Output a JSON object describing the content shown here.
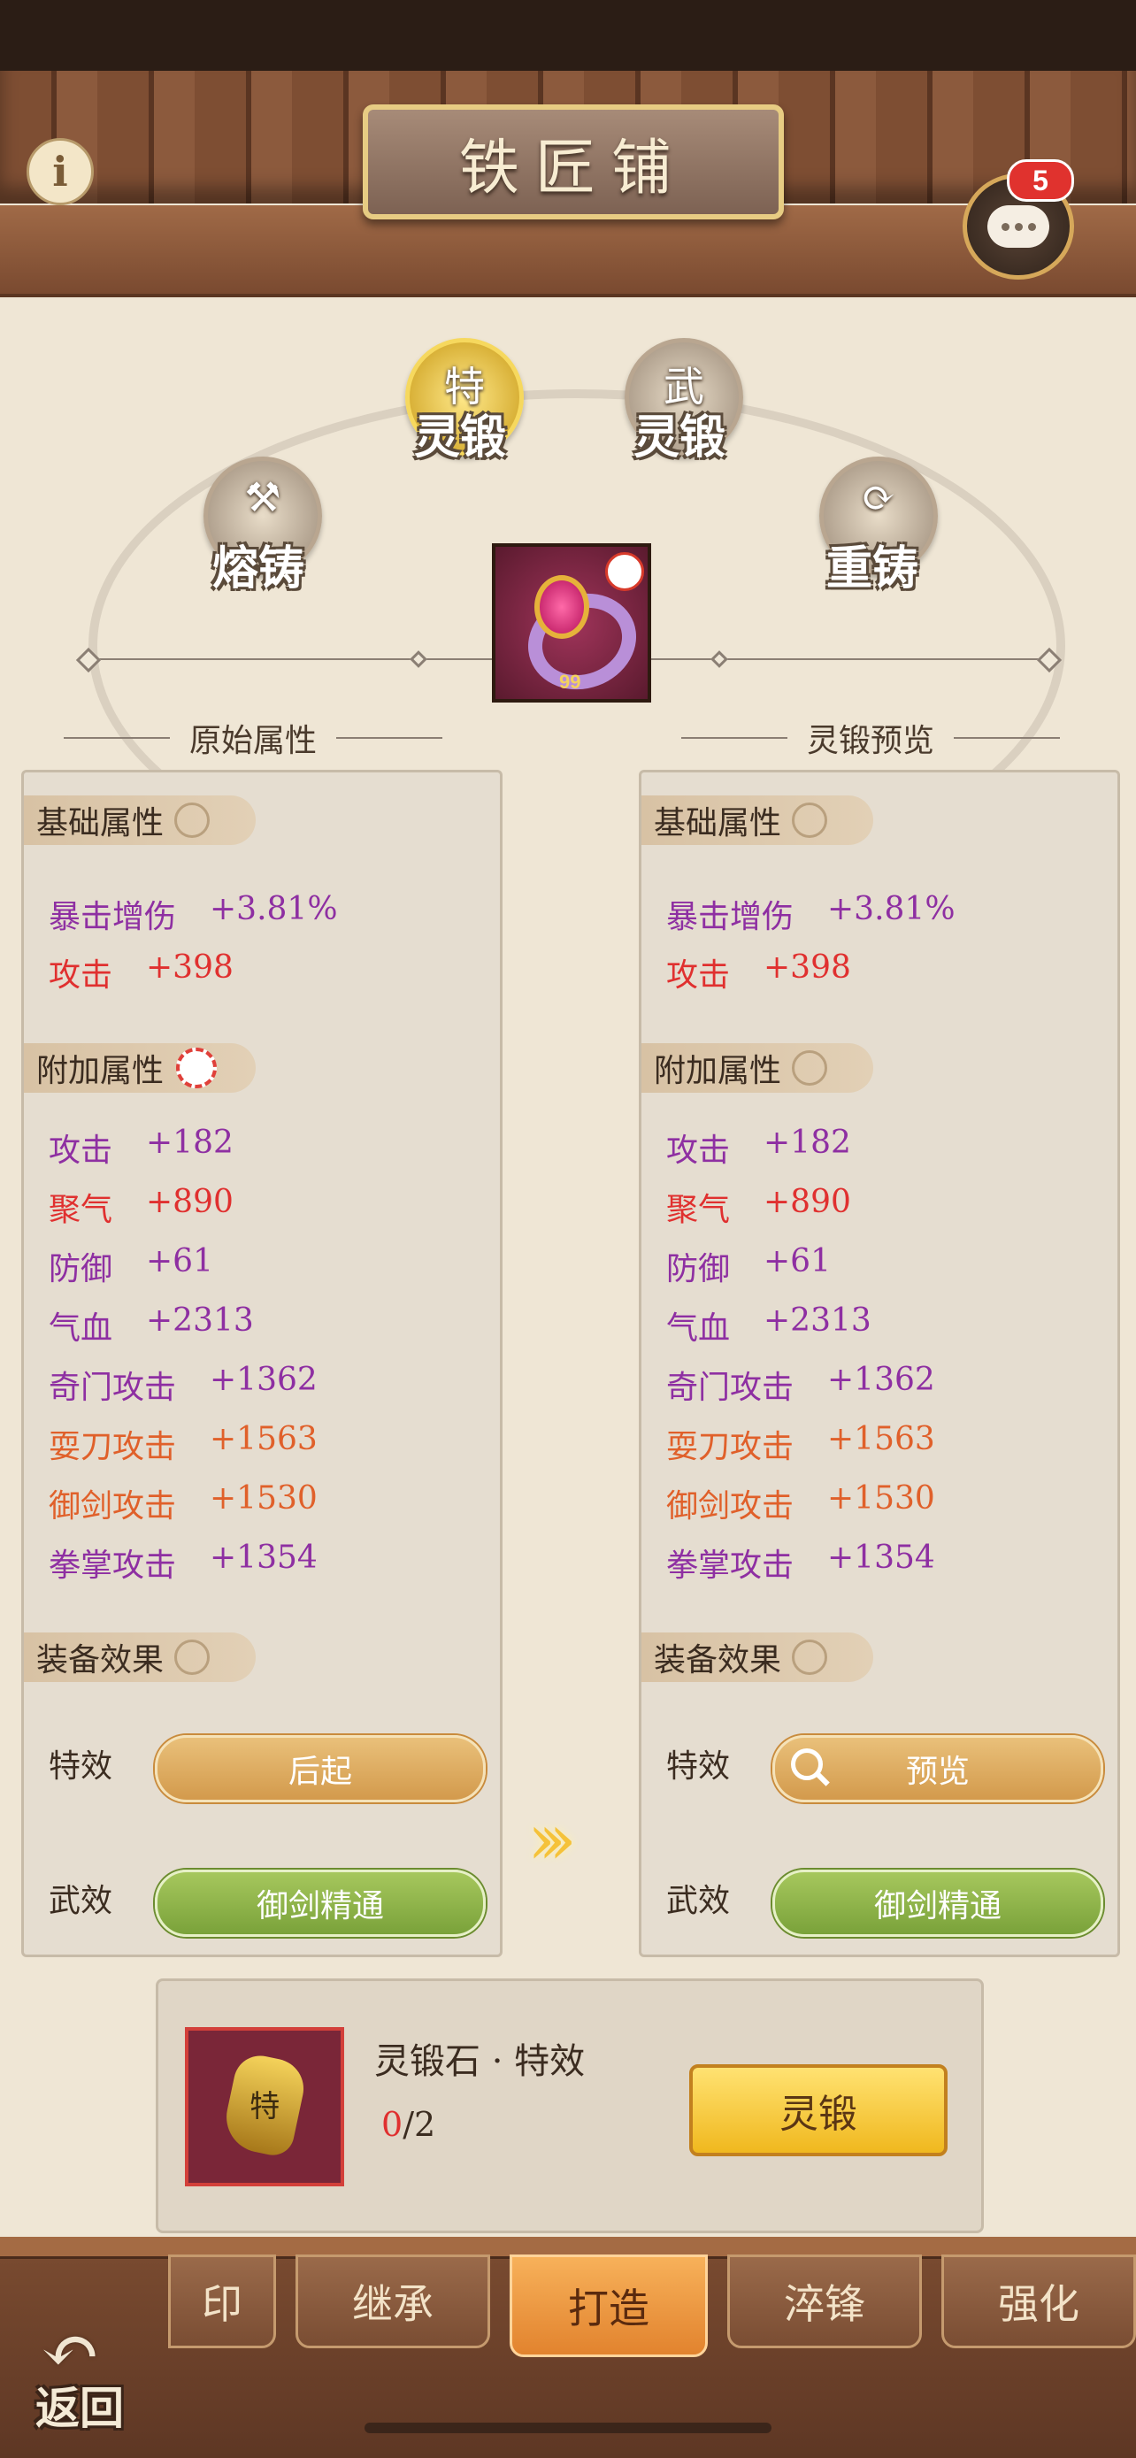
{
  "title": "铁匠铺",
  "chat": {
    "badge": "5"
  },
  "modes": {
    "top": [
      {
        "glyph": "特",
        "label": "灵锻",
        "active": true
      },
      {
        "glyph": "武",
        "label": "灵锻",
        "active": false
      }
    ],
    "side": [
      {
        "label": "熔铸"
      },
      {
        "label": "重铸"
      }
    ]
  },
  "item": {
    "level": "99"
  },
  "left": {
    "header": "原始属性",
    "base_tag": "基础属性",
    "base": [
      {
        "name": "暴击增伤",
        "value": "+3.81%",
        "color": "purple"
      },
      {
        "name": "攻击",
        "value": "+398",
        "color": "red"
      }
    ],
    "extra_tag": "附加属性",
    "extra": [
      {
        "name": "攻击",
        "value": "+182",
        "color": "purple"
      },
      {
        "name": "聚气",
        "value": "+890",
        "color": "red"
      },
      {
        "name": "防御",
        "value": "+61",
        "color": "purple"
      },
      {
        "name": "气血",
        "value": "+2313",
        "color": "purple"
      },
      {
        "name": "奇门攻击",
        "value": "+1362",
        "color": "purple"
      },
      {
        "name": "耍刀攻击",
        "value": "+1563",
        "color": "orange"
      },
      {
        "name": "御剑攻击",
        "value": "+1530",
        "color": "orange"
      },
      {
        "name": "拳掌攻击",
        "value": "+1354",
        "color": "purple"
      }
    ],
    "effect_tag": "装备效果",
    "special_label": "特效",
    "special_value": "后起",
    "martial_label": "武效",
    "martial_value": "御剑精通"
  },
  "right": {
    "header": "灵锻预览",
    "base_tag": "基础属性",
    "base": [
      {
        "name": "暴击增伤",
        "value": "+3.81%",
        "color": "purple"
      },
      {
        "name": "攻击",
        "value": "+398",
        "color": "red"
      }
    ],
    "extra_tag": "附加属性",
    "extra": [
      {
        "name": "攻击",
        "value": "+182",
        "color": "purple"
      },
      {
        "name": "聚气",
        "value": "+890",
        "color": "red"
      },
      {
        "name": "防御",
        "value": "+61",
        "color": "purple"
      },
      {
        "name": "气血",
        "value": "+2313",
        "color": "purple"
      },
      {
        "name": "奇门攻击",
        "value": "+1362",
        "color": "purple"
      },
      {
        "name": "耍刀攻击",
        "value": "+1563",
        "color": "orange"
      },
      {
        "name": "御剑攻击",
        "value": "+1530",
        "color": "orange"
      },
      {
        "name": "拳掌攻击",
        "value": "+1354",
        "color": "purple"
      }
    ],
    "effect_tag": "装备效果",
    "special_label": "特效",
    "special_value": "预览",
    "martial_label": "武效",
    "martial_value": "御剑精通"
  },
  "material": {
    "stone_glyph": "特",
    "name": "灵锻石 · 特效",
    "have": "0",
    "need": "/2",
    "button": "灵锻"
  },
  "nav": {
    "tabs": [
      "印",
      "继承",
      "打造",
      "淬锋",
      "强化"
    ],
    "active_index": 2,
    "back": "返回"
  }
}
